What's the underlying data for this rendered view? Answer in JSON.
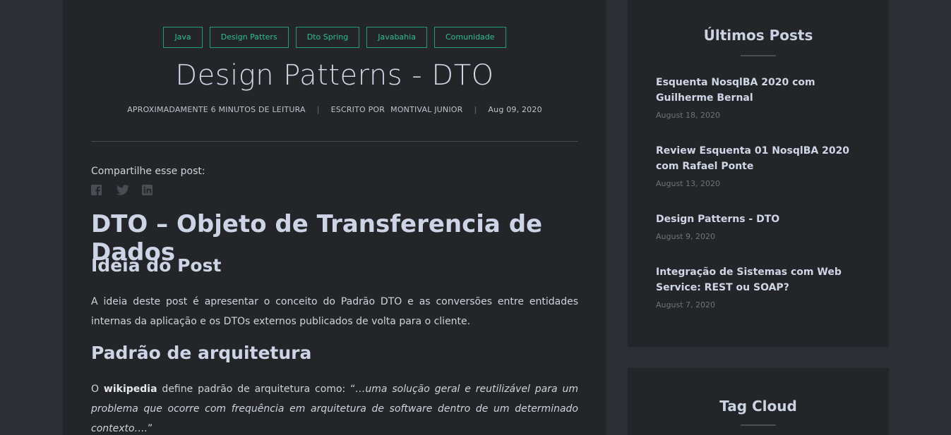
{
  "tags": [
    "Java",
    "Design Patters",
    "Dto Spring",
    "Javabahia",
    "Comunidade"
  ],
  "post": {
    "title": "Design Patterns - DTO",
    "reading_time": "APROXIMADAMENTE 6 MINUTOS DE LEITURA",
    "written_by_label": "ESCRITO POR",
    "author": "MONTIVAL JUNIOR",
    "date": "Aug 09, 2020",
    "share_label": "Compartilhe esse post:",
    "share_icons": [
      "facebook-icon",
      "twitter-icon",
      "linkedin-icon"
    ],
    "h1": "DTO – Objeto de Transferencia de Dados",
    "section1_title": "Ideia do Post",
    "section1_text": "A ideia deste post é apresentar o conceito do Padrão DTO e as conversões entre entidades internas da aplicação e os DTOs externos publicados de volta para o cliente.",
    "section2_title": "Padrão de arquitetura",
    "section2_prefix": "O ",
    "section2_bold": "wikipedia",
    "section2_middle": " define padrão de arquitetura como: “",
    "section2_quote": "…uma solução geral e reutilizável para um problema que ocorre com frequência em arquitetura de software dentro de um determinado contexto….",
    "section2_suffix": "”"
  },
  "sidebar": {
    "latest_title": "Últimos Posts",
    "latest_posts": [
      {
        "title": "Esquenta NosqlBA 2020 com Guilherme Bernal",
        "date": "August 18, 2020"
      },
      {
        "title": "Review Esquenta 01 NosqlBA 2020 com Rafael Ponte",
        "date": "August 13, 2020"
      },
      {
        "title": "Design Patterns - DTO",
        "date": "August 9, 2020"
      },
      {
        "title": "Integração de Sistemas com Web Service: REST ou SOAP?",
        "date": "August 7, 2020"
      }
    ],
    "tag_cloud_title": "Tag Cloud"
  },
  "colors": {
    "background": "#2d2f36",
    "card": "#242529",
    "tag_accent": "#2fbf91"
  }
}
